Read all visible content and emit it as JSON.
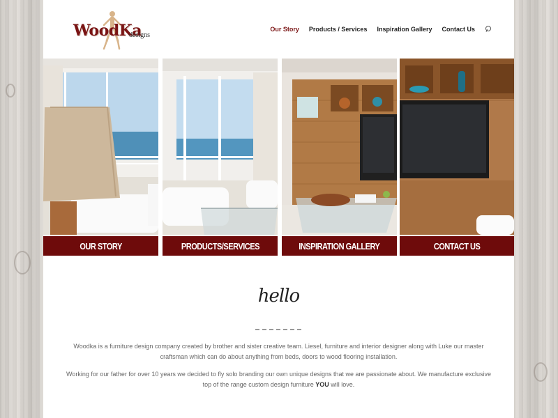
{
  "logo": {
    "brand": "WoodKa",
    "suffix": "designs"
  },
  "nav": {
    "items": [
      {
        "label": "Our Story",
        "active": true
      },
      {
        "label": "Products / Services",
        "active": false
      },
      {
        "label": "Inspiration Gallery",
        "active": false
      },
      {
        "label": "Contact Us",
        "active": false
      }
    ],
    "search_icon": "search-icon"
  },
  "panels": [
    {
      "label": "OUR STORY"
    },
    {
      "label": "PRODUCTS/SERVICES"
    },
    {
      "label": "INSPIRATION GALLERY"
    },
    {
      "label": "CONTACT US"
    }
  ],
  "hello": {
    "title": "hello",
    "paragraph1": "Woodka is a furniture design company created by brother and sister creative team. Liesel, furniture and interior designer along with Luke our master craftsman which can do about anything from beds, doors to wood flooring installation.",
    "paragraph2_before": "Working for our father for over 10 years we decided to fly solo branding our own unique designs that we are passionate about. We manufacture exclusive top of the range custom design furniture ",
    "paragraph2_bold": "YOU",
    "paragraph2_after": " will love."
  },
  "colors": {
    "brand_red": "#6e0b0b",
    "active_nav": "#7a1414"
  }
}
